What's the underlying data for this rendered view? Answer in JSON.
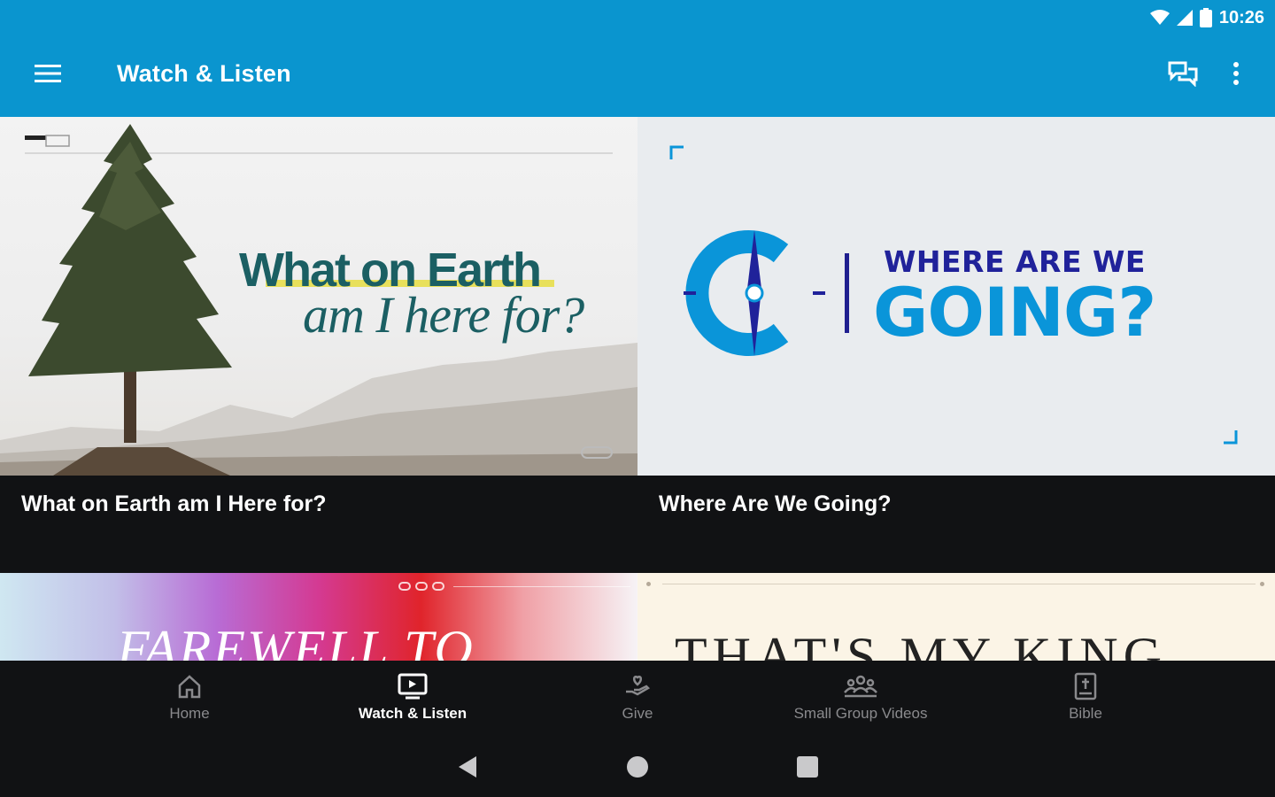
{
  "status_bar": {
    "time": "10:26",
    "icons": [
      "wifi-icon",
      "signal-icon",
      "battery-icon"
    ]
  },
  "app_bar": {
    "title": "Watch & Listen",
    "menu_icon": "menu-icon",
    "chat_icon": "chat-icon",
    "more_icon": "more-vert-icon",
    "color": "#0a95cf"
  },
  "cards": [
    {
      "title": "What on Earth am I Here for?",
      "art_line1": "What on Earth",
      "art_line2": "am I here for?"
    },
    {
      "title": "Where Are We Going?",
      "art_line1": "WHERE ARE WE",
      "art_line2": "GOING?"
    },
    {
      "title": "",
      "art_text": "FAREWELL TO"
    },
    {
      "title": "",
      "art_text": "THAT'S MY KING"
    }
  ],
  "bottom_nav": {
    "items": [
      {
        "label": "Home",
        "icon": "home-icon",
        "active": false
      },
      {
        "label": "Watch & Listen",
        "icon": "tv-icon",
        "active": true
      },
      {
        "label": "Give",
        "icon": "give-hand-icon",
        "active": false
      },
      {
        "label": "Small Group Videos",
        "icon": "group-icon",
        "active": false
      },
      {
        "label": "Bible",
        "icon": "bible-icon",
        "active": false
      }
    ]
  },
  "system_nav": {
    "icons": [
      "back-icon",
      "home-circle-icon",
      "recents-icon"
    ]
  }
}
